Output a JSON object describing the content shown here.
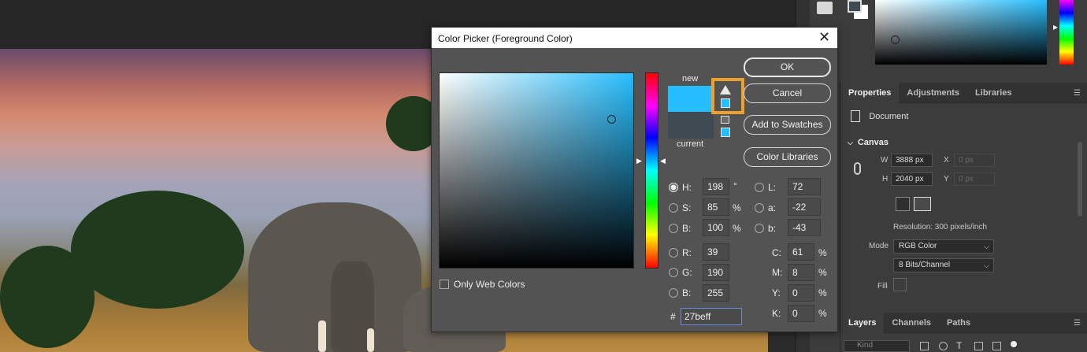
{
  "dialog": {
    "title": "Color Picker (Foreground Color)",
    "new_label": "new",
    "current_label": "current",
    "buttons": {
      "ok": "OK",
      "cancel": "Cancel",
      "add_to_swatches": "Add to Swatches",
      "color_libraries": "Color Libraries"
    },
    "only_web_colors": "Only Web Colors",
    "hsb": [
      {
        "label": "H:",
        "value": "198",
        "unit": "°",
        "selected": true
      },
      {
        "label": "S:",
        "value": "85",
        "unit": "%",
        "selected": false
      },
      {
        "label": "B:",
        "value": "100",
        "unit": "%",
        "selected": false
      }
    ],
    "rgb": [
      {
        "label": "R:",
        "value": "39"
      },
      {
        "label": "G:",
        "value": "190"
      },
      {
        "label": "B:",
        "value": "255"
      }
    ],
    "lab": [
      {
        "label": "L:",
        "value": "72"
      },
      {
        "label": "a:",
        "value": "-22"
      },
      {
        "label": "b:",
        "value": "-43"
      }
    ],
    "cmyk": [
      {
        "label": "C:",
        "value": "61",
        "unit": "%"
      },
      {
        "label": "M:",
        "value": "8",
        "unit": "%"
      },
      {
        "label": "Y:",
        "value": "0",
        "unit": "%"
      },
      {
        "label": "K:",
        "value": "0",
        "unit": "%"
      }
    ],
    "hex_label": "#",
    "hex_value": "27beff",
    "colors": {
      "new": "#27beff",
      "current": "#3f4a52",
      "gamut_highlight": "#f0a12a"
    }
  },
  "properties_panel": {
    "tabs": [
      "Properties",
      "Adjustments",
      "Libraries"
    ],
    "document_label": "Document",
    "canvas_heading": "Canvas",
    "w_label": "W",
    "w_value": "3888 px",
    "h_label": "H",
    "h_value": "2040 px",
    "x_label": "X",
    "x_value": "0 px",
    "y_label": "Y",
    "y_value": "0 px",
    "resolution": "Resolution: 300 pixels/inch",
    "mode_label": "Mode",
    "mode_value": "RGB Color",
    "bits_value": "8 Bits/Channel",
    "fill_label": "Fill"
  },
  "layers_panel": {
    "tabs": [
      "Layers",
      "Channels",
      "Paths"
    ],
    "filter_placeholder": "Kind"
  }
}
